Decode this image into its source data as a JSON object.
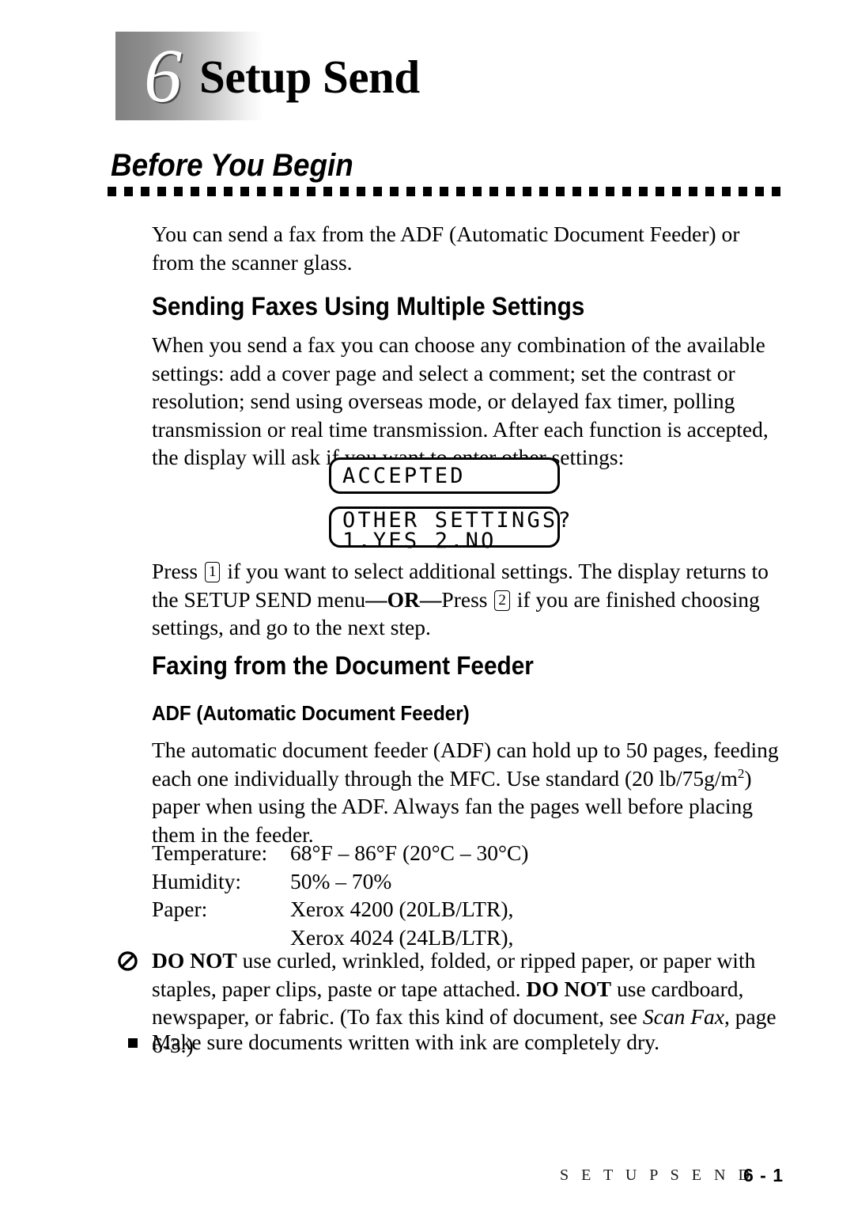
{
  "chapter": {
    "number": "6",
    "title": "Setup Send"
  },
  "section": {
    "heading": "Before You Begin",
    "intro": "You can send a fax from the ADF (Automatic Document Feeder) or from the scanner glass."
  },
  "multiple_settings": {
    "heading": "Sending Faxes Using Multiple Settings",
    "paragraph": "When you send a fax you can choose any combination of the available settings:  add a cover page and select a comment; set the contrast or resolution; send using overseas mode, or delayed fax timer, polling transmission or real time transmission. After each function is accepted, the display will ask if you want to enter other settings:",
    "lcd_panels": [
      {
        "line1": "ACCEPTED",
        "line2": ""
      },
      {
        "line1": "OTHER SETTINGS?",
        "line2": "1.YES 2.NO"
      }
    ],
    "press_instruction": {
      "part1": "Press ",
      "key1": "1",
      "part2": " if you want to select additional settings. The display returns to the SETUP SEND menu",
      "or": "—OR—",
      "part3": "Press ",
      "key2": "2",
      "part4": " if you are finished choosing settings, and go to the next step."
    }
  },
  "document_feeder": {
    "heading": "Faxing from the Document Feeder",
    "subheading": "ADF (Automatic Document Feeder)",
    "paragraph_part1": "The automatic document feeder (ADF) can hold up to 50 pages, feeding each one individually through the MFC. Use standard (20 lb/75g/m",
    "paragraph_superscript": "2",
    "paragraph_part2": ") paper when using the ADF. Always fan the pages well before placing them in the feeder.",
    "specs": [
      {
        "label": "Temperature:",
        "value": "68°F – 86°F (20°C – 30°C)"
      },
      {
        "label": "Humidity:",
        "value": "50% – 70%"
      },
      {
        "label": "Paper:",
        "value": "Xerox 4200 (20LB/LTR),"
      },
      {
        "label": "",
        "value": "Xerox 4024 (24LB/LTR),"
      }
    ]
  },
  "notices": {
    "prohibition": {
      "icon": "prohibition-icon",
      "bold1": "DO NOT",
      "text1": " use curled, wrinkled, folded, or ripped paper, or paper with staples, paper clips, paste or tape attached. ",
      "bold2": "DO NOT",
      "text2": " use cardboard, newspaper, or fabric. (To fax this kind of document, see ",
      "italic": "Scan Fax",
      "text3": ", page 6-3.)"
    },
    "bullet": {
      "icon": "square-bullet-icon",
      "text": "Make sure documents written with ink are completely dry."
    }
  },
  "footer": {
    "title": "S E T U P   S E N D",
    "page": "6 - 1"
  },
  "colors": {
    "text": "#000000",
    "page_background": "#ffffff",
    "badge_gradient_start": "#808080",
    "badge_gradient_end": "#ffffff"
  }
}
